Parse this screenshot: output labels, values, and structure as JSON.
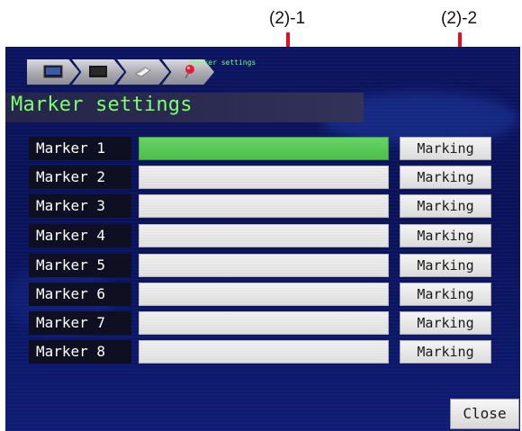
{
  "callouts": [
    {
      "label": "(2)-1"
    },
    {
      "label": "(2)-2"
    }
  ],
  "breadcrumb": {
    "title": "Marker settings",
    "steps": [
      {
        "icon": "monitor-icon"
      },
      {
        "icon": "screen-icon"
      },
      {
        "icon": "document-icon"
      },
      {
        "icon": "pin-icon"
      }
    ]
  },
  "header": {
    "title": "Marker settings"
  },
  "markers": [
    {
      "label": "Marker 1",
      "action": "Marking",
      "active": true
    },
    {
      "label": "Marker 2",
      "action": "Marking",
      "active": false
    },
    {
      "label": "Marker 3",
      "action": "Marking",
      "active": false
    },
    {
      "label": "Marker 4",
      "action": "Marking",
      "active": false
    },
    {
      "label": "Marker 5",
      "action": "Marking",
      "active": false
    },
    {
      "label": "Marker 6",
      "action": "Marking",
      "active": false
    },
    {
      "label": "Marker 7",
      "action": "Marking",
      "active": false
    },
    {
      "label": "Marker 8",
      "action": "Marking",
      "active": false
    }
  ],
  "footer": {
    "close_label": "Close"
  },
  "colors": {
    "accent_green": "#4cbf4c",
    "title_green": "#7dff6e",
    "callout_red": "#e01020",
    "background_blue": "#0c1460"
  }
}
